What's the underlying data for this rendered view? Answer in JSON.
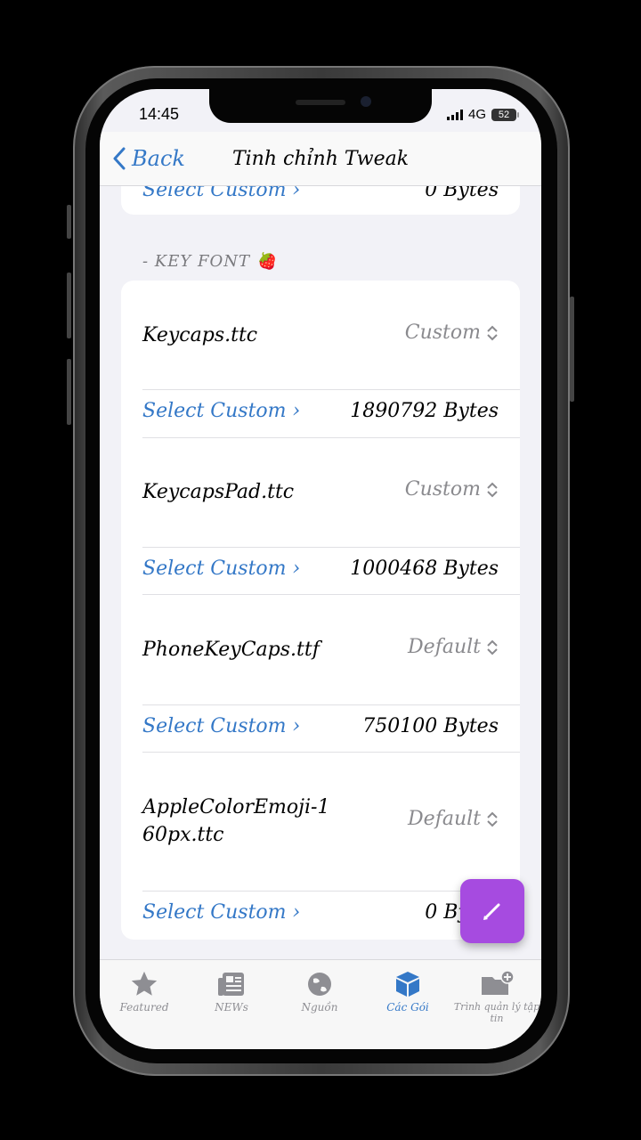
{
  "status": {
    "time": "14:45",
    "network": "4G",
    "battery": "52"
  },
  "nav": {
    "back_label": "Back",
    "title": "Tinh chỉnh Tweak"
  },
  "top_row": {
    "link": "Select Custom ›",
    "bytes": "0 Bytes"
  },
  "section_header": "- KEY FONT 🍓",
  "rows": [
    {
      "file": "Keycaps.ttc",
      "mode": "Custom",
      "link": "Select Custom ›",
      "bytes": "1890792 Bytes"
    },
    {
      "file": "KeycapsPad.ttc",
      "mode": "Custom",
      "link": "Select Custom ›",
      "bytes": "1000468 Bytes"
    },
    {
      "file": "PhoneKeyCaps.ttf",
      "mode": "Default",
      "link": "Select Custom ›",
      "bytes": "750100 Bytes"
    },
    {
      "file_line1": "AppleColorEmoji-1",
      "file_line2": "60px.ttc",
      "mode": "Default",
      "link": "Select Custom ›",
      "bytes": "0 Bytes"
    }
  ],
  "tabs": [
    {
      "label": "Featured",
      "icon": "star-icon"
    },
    {
      "label": "NEWs",
      "icon": "newspaper-icon"
    },
    {
      "label": "Nguồn",
      "icon": "globe-icon"
    },
    {
      "label": "Các Gói",
      "icon": "package-icon",
      "active": true
    },
    {
      "label": "Trình quản lý tập tin",
      "icon": "folder-add-icon"
    }
  ],
  "colors": {
    "accent": "#3478c7",
    "fab": "#a64be0",
    "muted": "#8a8a8e"
  }
}
